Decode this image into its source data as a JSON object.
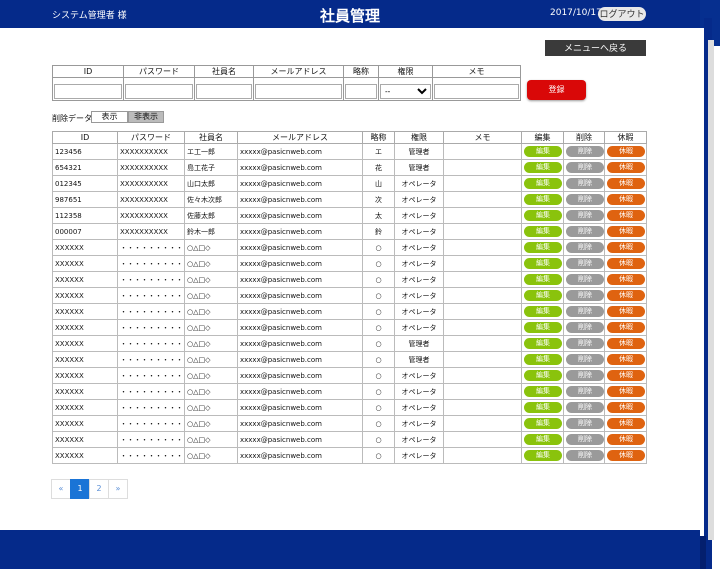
{
  "header": {
    "user_label": "システム管理者 様",
    "title": "社員管理",
    "date": "2017/10/17",
    "logout_label": "ログアウト"
  },
  "menu_back_label": "メニューへ戻る",
  "search": {
    "columns": [
      "ID",
      "パスワード",
      "社員名",
      "メールアドレス",
      "略称",
      "権限",
      "メモ"
    ],
    "role_select_value": "--",
    "register_label": "登録"
  },
  "deleted_filter": {
    "label": "削除データ",
    "show_label": "表示",
    "hide_label": "非表示"
  },
  "table": {
    "headers": [
      "ID",
      "パスワード",
      "社員名",
      "メールアドレス",
      "略称",
      "権限",
      "メモ",
      "編集",
      "削除",
      "休暇"
    ],
    "edit_label": "編集",
    "delete_label": "削除",
    "leave_label": "休暇",
    "rows": [
      {
        "id": "123456",
        "password": "XXXXXXXXXX",
        "name": "エ工一郎",
        "email": "xxxxx@pasicnweb.com",
        "abbr": "エ",
        "role": "管理者",
        "memo": ""
      },
      {
        "id": "654321",
        "password": "XXXXXXXXXX",
        "name": "島工花子",
        "email": "xxxxx@pasicnweb.com",
        "abbr": "花",
        "role": "管理者",
        "memo": ""
      },
      {
        "id": "012345",
        "password": "XXXXXXXXXX",
        "name": "山口太郎",
        "email": "xxxxx@pasicnweb.com",
        "abbr": "山",
        "role": "オペレータ",
        "memo": ""
      },
      {
        "id": "987651",
        "password": "XXXXXXXXXX",
        "name": "佐々木次郎",
        "email": "xxxxx@pasicnweb.com",
        "abbr": "次",
        "role": "オペレータ",
        "memo": ""
      },
      {
        "id": "112358",
        "password": "XXXXXXXXXX",
        "name": "佐藤太郎",
        "email": "xxxxx@pasicnweb.com",
        "abbr": "太",
        "role": "オペレータ",
        "memo": ""
      },
      {
        "id": "000007",
        "password": "XXXXXXXXXX",
        "name": "鈴木一郎",
        "email": "xxxxx@pasicnweb.com",
        "abbr": "鈴",
        "role": "オペレータ",
        "memo": ""
      },
      {
        "id": "XXXXXX",
        "password": "・・・・・・・・・・",
        "name": "○△□◇",
        "email": "xxxxx@pasicnweb.com",
        "abbr": "○",
        "role": "オペレータ",
        "memo": ""
      },
      {
        "id": "XXXXXX",
        "password": "・・・・・・・・・・",
        "name": "○△□◇",
        "email": "xxxxx@pasicnweb.com",
        "abbr": "○",
        "role": "オペレータ",
        "memo": ""
      },
      {
        "id": "XXXXXX",
        "password": "・・・・・・・・・・",
        "name": "○△□◇",
        "email": "xxxxx@pasicnweb.com",
        "abbr": "○",
        "role": "オペレータ",
        "memo": ""
      },
      {
        "id": "XXXXXX",
        "password": "・・・・・・・・・・",
        "name": "○△□◇",
        "email": "xxxxx@pasicnweb.com",
        "abbr": "○",
        "role": "オペレータ",
        "memo": ""
      },
      {
        "id": "XXXXXX",
        "password": "・・・・・・・・・・",
        "name": "○△□◇",
        "email": "xxxxx@pasicnweb.com",
        "abbr": "○",
        "role": "オペレータ",
        "memo": ""
      },
      {
        "id": "XXXXXX",
        "password": "・・・・・・・・・・",
        "name": "○△□◇",
        "email": "xxxxx@pasicnweb.com",
        "abbr": "○",
        "role": "オペレータ",
        "memo": ""
      },
      {
        "id": "XXXXXX",
        "password": "・・・・・・・・・・",
        "name": "○△□◇",
        "email": "xxxxx@pasicnweb.com",
        "abbr": "○",
        "role": "管理者",
        "memo": ""
      },
      {
        "id": "XXXXXX",
        "password": "・・・・・・・・・・",
        "name": "○△□◇",
        "email": "xxxxx@pasicnweb.com",
        "abbr": "○",
        "role": "管理者",
        "memo": ""
      },
      {
        "id": "XXXXXX",
        "password": "・・・・・・・・・・",
        "name": "○△□◇",
        "email": "xxxxx@pasicnweb.com",
        "abbr": "○",
        "role": "オペレータ",
        "memo": ""
      },
      {
        "id": "XXXXXX",
        "password": "・・・・・・・・・・",
        "name": "○△□◇",
        "email": "xxxxx@pasicnweb.com",
        "abbr": "○",
        "role": "オペレータ",
        "memo": ""
      },
      {
        "id": "XXXXXX",
        "password": "・・・・・・・・・・",
        "name": "○△□◇",
        "email": "xxxxx@pasicnweb.com",
        "abbr": "○",
        "role": "オペレータ",
        "memo": ""
      },
      {
        "id": "XXXXXX",
        "password": "・・・・・・・・・・",
        "name": "○△□◇",
        "email": "xxxxx@pasicnweb.com",
        "abbr": "○",
        "role": "オペレータ",
        "memo": ""
      },
      {
        "id": "XXXXXX",
        "password": "・・・・・・・・・・",
        "name": "○△□◇",
        "email": "xxxxx@pasicnweb.com",
        "abbr": "○",
        "role": "オペレータ",
        "memo": ""
      },
      {
        "id": "XXXXXX",
        "password": "・・・・・・・・・・",
        "name": "○△□◇",
        "email": "xxxxx@pasicnweb.com",
        "abbr": "○",
        "role": "オペレータ",
        "memo": ""
      }
    ]
  },
  "pagination": {
    "prev": "«",
    "pages": [
      "1",
      "2"
    ],
    "current": "1",
    "next": "»"
  },
  "colors": {
    "header_bg": "#052a8a",
    "edit": "#8ac30c",
    "delete": "#9a9a9a",
    "leave": "#df6310",
    "register": "#d90808",
    "page_active": "#1a74d6"
  }
}
